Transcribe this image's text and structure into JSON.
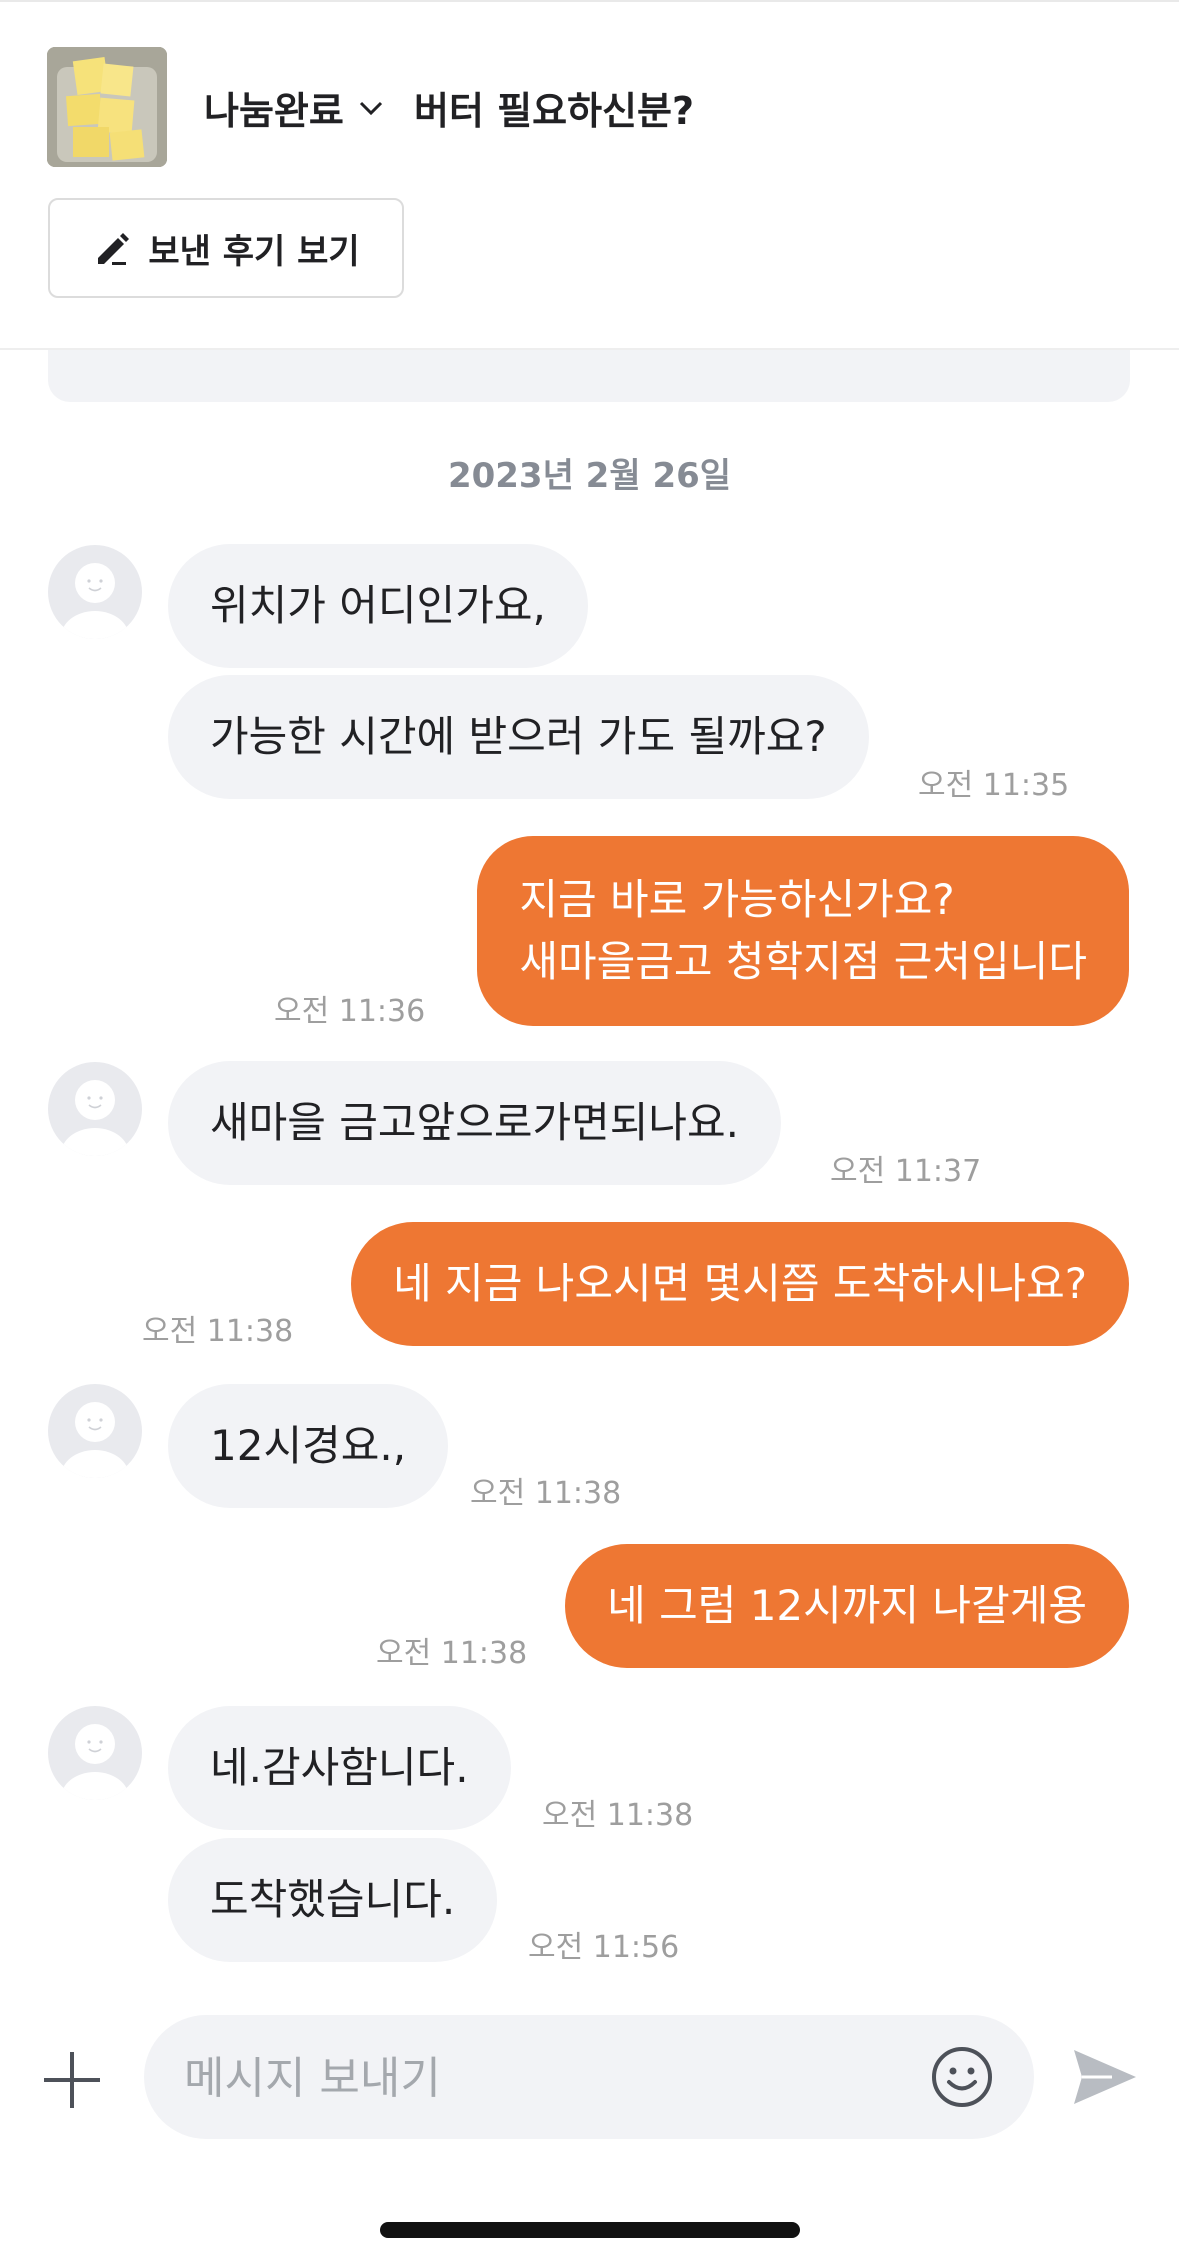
{
  "header": {
    "status_label": "나눔완료",
    "post_title": "버터 필요하신분?",
    "review_button_label": "보낸 후기 보기"
  },
  "date_divider": "2023년 2월 26일",
  "messages": [
    {
      "text": "위치가 어디인가요,"
    },
    {
      "text": "가능한 시간에 받으러 가도 될까요?",
      "time": "오전 11:35"
    },
    {
      "lines": [
        "지금 바로 가능하신가요?",
        "새마을금고 청학지점 근처입니다"
      ],
      "time": "오전 11:36"
    },
    {
      "text": "새마을 금고앞으로가면되나요.",
      "time": "오전 11:37"
    },
    {
      "text": "네 지금 나오시면 몇시쯤 도착하시나요?",
      "time": "오전 11:38"
    },
    {
      "text": "12시경요.,",
      "time": "오전 11:38"
    },
    {
      "text": "네 그럼 12시까지 나갈게용",
      "time": "오전 11:38"
    },
    {
      "text": "네.감사함니다.",
      "time": "오전 11:38"
    },
    {
      "text": "도착했습니다.",
      "time": "오전 11:56"
    }
  ],
  "composer": {
    "placeholder": "메시지 보내기"
  },
  "icons": {
    "status_dropdown": "chevron-down-icon",
    "review": "pencil-icon",
    "attach": "plus-icon",
    "emoji": "smiley-icon",
    "send": "send-icon"
  },
  "colors": {
    "accent": "#ee7733",
    "incoming_bubble": "#f2f3f6",
    "timestamp": "#9e9e9e"
  }
}
